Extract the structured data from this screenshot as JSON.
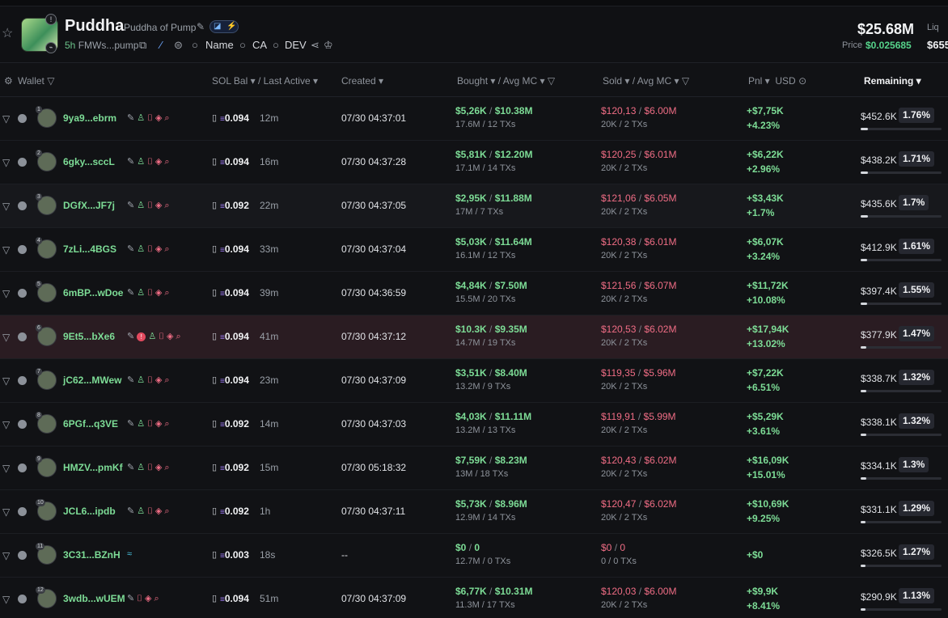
{
  "token": {
    "name": "Puddha",
    "full_name": "Puddha of Pump",
    "age": "5h",
    "address": "FMWs...pump",
    "search_links": [
      "Name",
      "CA",
      "DEV"
    ],
    "market_cap": "$25.68M",
    "price_label": "Price",
    "price": "$0.025685",
    "liq_label": "Liq",
    "liq": "$655"
  },
  "columns": {
    "wallet": "Wallet",
    "sol_bal": "SOL Bal",
    "last_active": "Last Active",
    "created": "Created",
    "bought": "Bought",
    "avg_mc_b": "Avg MC",
    "sold": "Sold",
    "avg_mc_s": "Avg MC",
    "pnl": "Pnl",
    "usd": "USD",
    "remaining": "Remaining"
  },
  "icons": {
    "star": "star-icon",
    "copy": "copy-icon",
    "edit": "pencil-icon",
    "search": "search-icon",
    "share": "share-icon",
    "crown": "crown-icon",
    "filter": "filter-icon",
    "sol": "solana-icon"
  },
  "colors": {
    "buy": "#7ddc96",
    "sell": "#f06d85",
    "accent": "#56d48b",
    "highlight_row": "#2a1c22"
  },
  "rows": [
    {
      "rank": "1",
      "wallet": "9ya9...ebrm",
      "sol": "0.094",
      "active": "12m",
      "created": "07/30 04:37:01",
      "bought": "$5,26K",
      "bought_mc": "$10.38M",
      "bought_tx": "17.6M / 12 TXs",
      "sold": "$120,13",
      "sold_mc": "$6.00M",
      "sold_tx": "20K / 2 TXs",
      "pnl": "+$7,75K",
      "pnl_pct": "+4.23%",
      "remaining": "$452.6K",
      "rem_pct": "1.76%",
      "rem_frac": 0.0176
    },
    {
      "rank": "2",
      "wallet": "6gky...sccL",
      "sol": "0.094",
      "active": "16m",
      "created": "07/30 04:37:28",
      "bought": "$5,81K",
      "bought_mc": "$12.20M",
      "bought_tx": "17.1M / 14 TXs",
      "sold": "$120,25",
      "sold_mc": "$6.01M",
      "sold_tx": "20K / 2 TXs",
      "pnl": "+$6,22K",
      "pnl_pct": "+2.96%",
      "remaining": "$438.2K",
      "rem_pct": "1.71%",
      "rem_frac": 0.0171
    },
    {
      "rank": "3",
      "wallet": "DGfX...JF7j",
      "sol": "0.092",
      "active": "22m",
      "created": "07/30 04:37:05",
      "bought": "$2,95K",
      "bought_mc": "$11.88M",
      "bought_tx": "17M / 7 TXs",
      "sold": "$121,06",
      "sold_mc": "$6.05M",
      "sold_tx": "20K / 2 TXs",
      "pnl": "+$3,43K",
      "pnl_pct": "+1.7%",
      "remaining": "$435.6K",
      "rem_pct": "1.7%",
      "rem_frac": 0.017
    },
    {
      "rank": "4",
      "wallet": "7zLi...4BGS",
      "sol": "0.094",
      "active": "33m",
      "created": "07/30 04:37:04",
      "bought": "$5,03K",
      "bought_mc": "$11.64M",
      "bought_tx": "16.1M / 12 TXs",
      "sold": "$120,38",
      "sold_mc": "$6.01M",
      "sold_tx": "20K / 2 TXs",
      "pnl": "+$6,07K",
      "pnl_pct": "+3.24%",
      "remaining": "$412.9K",
      "rem_pct": "1.61%",
      "rem_frac": 0.0161
    },
    {
      "rank": "5",
      "wallet": "6mBP...wDoe",
      "sol": "0.094",
      "active": "39m",
      "created": "07/30 04:36:59",
      "bought": "$4,84K",
      "bought_mc": "$7.50M",
      "bought_tx": "15.5M / 20 TXs",
      "sold": "$121,56",
      "sold_mc": "$6.07M",
      "sold_tx": "20K / 2 TXs",
      "pnl": "+$11,72K",
      "pnl_pct": "+10.08%",
      "remaining": "$397.4K",
      "rem_pct": "1.55%",
      "rem_frac": 0.0155
    },
    {
      "rank": "6",
      "wallet": "9Et5...bXe6",
      "sol": "0.094",
      "active": "41m",
      "created": "07/30 04:37:12",
      "bought": "$10.3K",
      "bought_mc": "$9.35M",
      "bought_tx": "14.7M / 19 TXs",
      "sold": "$120,53",
      "sold_mc": "$6.02M",
      "sold_tx": "20K / 2 TXs",
      "pnl": "+$17,94K",
      "pnl_pct": "+13.02%",
      "remaining": "$377.9K",
      "rem_pct": "1.47%",
      "rem_frac": 0.0147
    },
    {
      "rank": "7",
      "wallet": "jC62...MWew",
      "sol": "0.094",
      "active": "23m",
      "created": "07/30 04:37:09",
      "bought": "$3,51K",
      "bought_mc": "$8.40M",
      "bought_tx": "13.2M / 9 TXs",
      "sold": "$119,35",
      "sold_mc": "$5.96M",
      "sold_tx": "20K / 2 TXs",
      "pnl": "+$7,22K",
      "pnl_pct": "+6.51%",
      "remaining": "$338.7K",
      "rem_pct": "1.32%",
      "rem_frac": 0.0132
    },
    {
      "rank": "8",
      "wallet": "6PGf...q3VE",
      "sol": "0.092",
      "active": "14m",
      "created": "07/30 04:37:03",
      "bought": "$4,03K",
      "bought_mc": "$11.11M",
      "bought_tx": "13.2M / 13 TXs",
      "sold": "$119,91",
      "sold_mc": "$5.99M",
      "sold_tx": "20K / 2 TXs",
      "pnl": "+$5,29K",
      "pnl_pct": "+3.61%",
      "remaining": "$338.1K",
      "rem_pct": "1.32%",
      "rem_frac": 0.0132
    },
    {
      "rank": "9",
      "wallet": "HMZV...pmKf",
      "sol": "0.092",
      "active": "15m",
      "created": "07/30 05:18:32",
      "bought": "$7,59K",
      "bought_mc": "$8.23M",
      "bought_tx": "13M / 18 TXs",
      "sold": "$120,43",
      "sold_mc": "$6.02M",
      "sold_tx": "20K / 2 TXs",
      "pnl": "+$16,09K",
      "pnl_pct": "+15.01%",
      "remaining": "$334.1K",
      "rem_pct": "1.3%",
      "rem_frac": 0.013
    },
    {
      "rank": "10",
      "wallet": "JCL6...ipdb",
      "sol": "0.092",
      "active": "1h",
      "created": "07/30 04:37:11",
      "bought": "$5,73K",
      "bought_mc": "$8.96M",
      "bought_tx": "12.9M / 14 TXs",
      "sold": "$120,47",
      "sold_mc": "$6.02M",
      "sold_tx": "20K / 2 TXs",
      "pnl": "+$10,69K",
      "pnl_pct": "+9.25%",
      "remaining": "$331.1K",
      "rem_pct": "1.29%",
      "rem_frac": 0.0129
    },
    {
      "rank": "11",
      "wallet": "3C31...BZnH",
      "sol": "0.003",
      "active": "18s",
      "created": "--",
      "bought": "$0",
      "bought_mc": "0",
      "bought_tx": "12.7M / 0 TXs",
      "sold": "$0",
      "sold_mc": "0",
      "sold_tx": "0 / 0 TXs",
      "pnl": "+$0",
      "pnl_pct": "",
      "remaining": "$326.5K",
      "rem_pct": "1.27%",
      "rem_frac": 0.0127
    },
    {
      "rank": "12",
      "wallet": "3wdb...wUEM",
      "sol": "0.094",
      "active": "51m",
      "created": "07/30 04:37:09",
      "bought": "$6,77K",
      "bought_mc": "$10.31M",
      "bought_tx": "11.3M / 17 TXs",
      "sold": "$120,03",
      "sold_mc": "$6.00M",
      "sold_tx": "20K / 2 TXs",
      "pnl": "+$9,9K",
      "pnl_pct": "+8.41%",
      "remaining": "$290.9K",
      "rem_pct": "1.13%",
      "rem_frac": 0.0113
    }
  ]
}
